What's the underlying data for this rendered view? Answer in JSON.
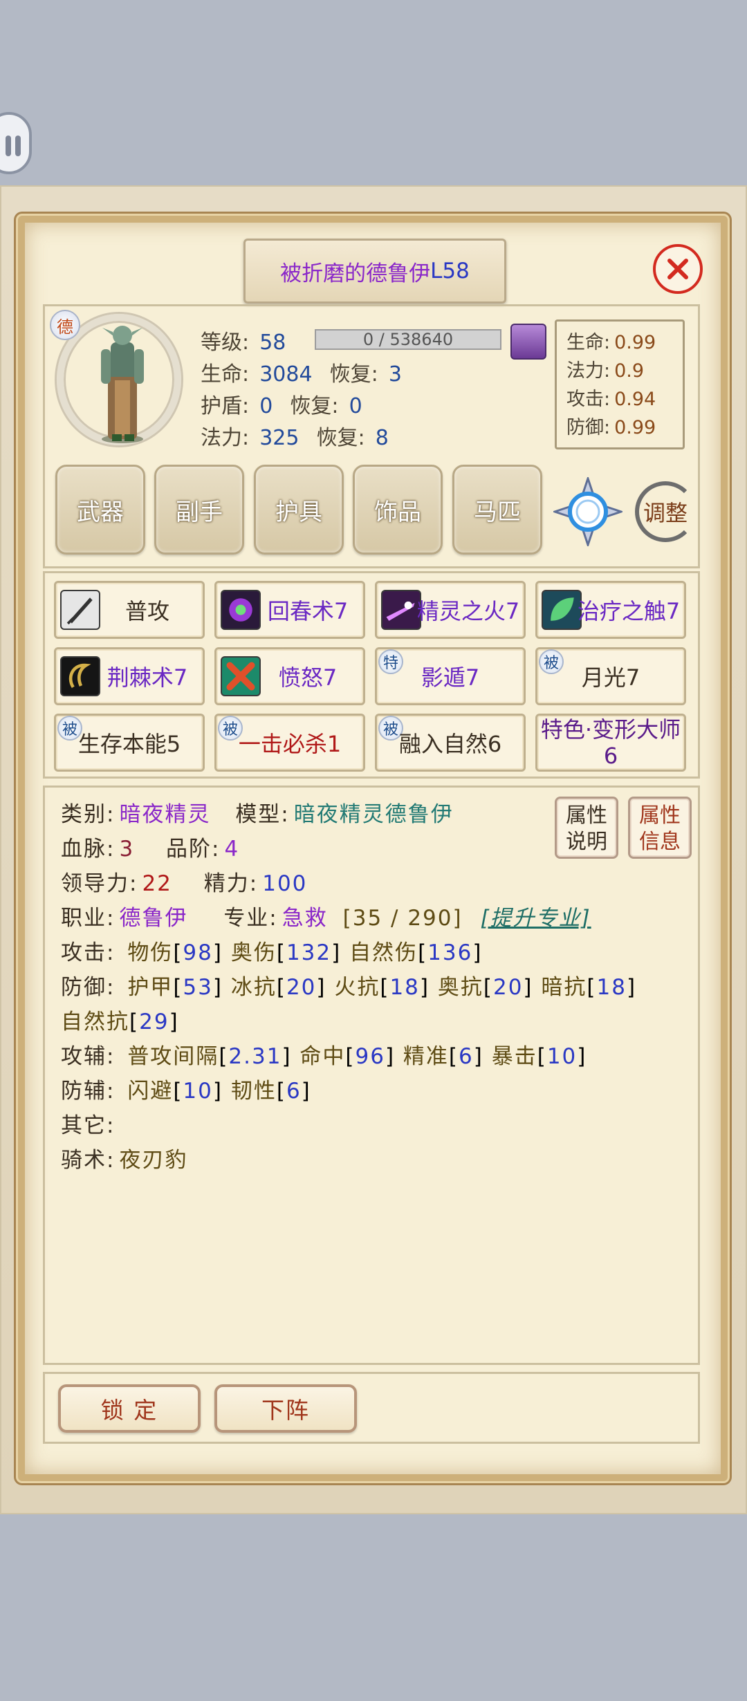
{
  "title": {
    "name": "被折磨的德鲁伊",
    "level": "L58"
  },
  "portrait_badge": "德",
  "stats": {
    "level_label": "等级:",
    "level": "58",
    "exp": "0 / 538640",
    "hp_label": "生命:",
    "hp": "3084",
    "hp_regen_label": "恢复:",
    "hp_regen": "3",
    "shield_label": "护盾:",
    "shield": "0",
    "shield_regen_label": "恢复:",
    "shield_regen": "0",
    "mp_label": "法力:",
    "mp": "325",
    "mp_regen_label": "恢复:",
    "mp_regen": "8"
  },
  "ratios": [
    {
      "k": "生命:",
      "v": "0.99"
    },
    {
      "k": "法力:",
      "v": "0.9"
    },
    {
      "k": "攻击:",
      "v": "0.94"
    },
    {
      "k": "防御:",
      "v": "0.99"
    }
  ],
  "equipment": [
    "武器",
    "副手",
    "护具",
    "饰品",
    "马匹"
  ],
  "adjust_label": "调整",
  "skills": [
    {
      "label": "普攻",
      "icon": "sword-icon",
      "color": "#3a2f22"
    },
    {
      "label": "回春术7",
      "icon": "rejuvenation-icon"
    },
    {
      "label": "精灵之火7",
      "icon": "faerie-fire-icon"
    },
    {
      "label": "治疗之触7",
      "icon": "healing-touch-icon"
    },
    {
      "label": "荆棘术7",
      "icon": "thorns-icon"
    },
    {
      "label": "愤怒7",
      "icon": "wrath-icon"
    },
    {
      "label": "影遁7",
      "tag": "特"
    },
    {
      "label": "月光7",
      "tag": "被",
      "color": "#3a2f22"
    },
    {
      "label": "生存本能5",
      "tag": "被",
      "color": "#3a2f22"
    },
    {
      "label": "一击必杀1",
      "tag": "被",
      "color": "#b01818"
    },
    {
      "label": "融入自然6",
      "tag": "被",
      "color": "#3a2f22"
    },
    {
      "label": "特色·变形大师6",
      "line1": "特色·变形大师",
      "line2": "6",
      "color": "#5a1b8a"
    }
  ],
  "attrs": {
    "type_label": "类别:",
    "type": "暗夜精灵",
    "model_label": "模型:",
    "model": "暗夜精灵德鲁伊",
    "blood_label": "血脉:",
    "blood": "3",
    "grade_label": "品阶:",
    "grade": "4",
    "leadership_label": "领导力:",
    "leadership": "22",
    "energy_label": "精力:",
    "energy": "100",
    "job_label": "职业:",
    "job": "德鲁伊",
    "major_label": "专业:",
    "major": "急救",
    "major_progress": "[35 / 290]",
    "upgrade_link": "[提升专业]",
    "attack_line": {
      "label": "攻击:",
      "p1": "物伤",
      "v1": "98",
      "p2": "奥伤",
      "v2": "132",
      "p3": "自然伤",
      "v3": "136"
    },
    "defense_line": {
      "label": "防御:",
      "p1": "护甲",
      "v1": "53",
      "p2": "冰抗",
      "v2": "20",
      "p3": "火抗",
      "v3": "18",
      "p4": "奥抗",
      "v4": "20",
      "p5": "暗抗",
      "v5": "18",
      "p6": "自然抗",
      "v6": "29"
    },
    "atk_aux_line": {
      "label": "攻辅:",
      "p1": "普攻间隔",
      "v1": "2.31",
      "p2": "命中",
      "v2": "96",
      "p3": "精准",
      "v3": "6",
      "p4": "暴击",
      "v4": "10"
    },
    "def_aux_line": {
      "label": "防辅:",
      "p1": "闪避",
      "v1": "10",
      "p2": "韧性",
      "v2": "6"
    },
    "other_label": "其它:",
    "riding_label": "骑术:",
    "riding": "夜刃豹"
  },
  "attr_buttons": {
    "explain_l1": "属性",
    "explain_l2": "说明",
    "info_l1": "属性",
    "info_l2": "信息"
  },
  "bottom": {
    "lock": "锁 定",
    "dismiss": "下阵"
  }
}
